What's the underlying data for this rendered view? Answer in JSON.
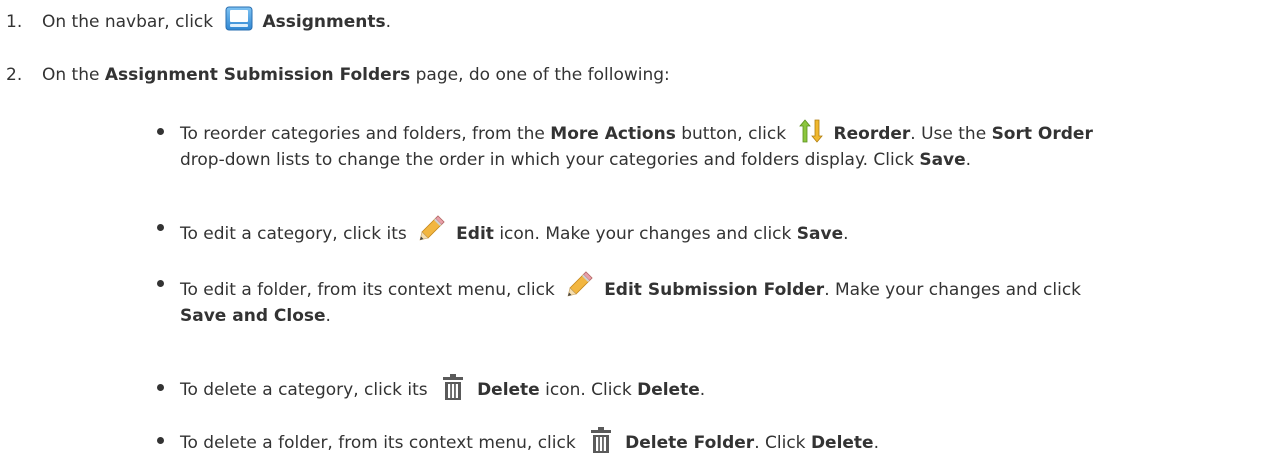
{
  "steps": [
    {
      "number": "1.",
      "prefix": "On the navbar, click",
      "icon": "assignments-icon",
      "bold": "Assignments",
      "suffix": "."
    },
    {
      "number": "2.",
      "prefix": "On the",
      "bold": "Assignment Submission Folders",
      "suffix": "page, do one of the following:"
    }
  ],
  "bullets": {
    "reorder": {
      "t1": "To reorder categories and folders, from the",
      "b1": "More Actions",
      "t2": "button, click",
      "icon": "reorder-icon",
      "b2": "Reorder",
      "t3": ". Use the",
      "b3": "Sort Order",
      "t4": "drop-down lists to change the order in which your categories and folders display. Click",
      "b4": "Save",
      "t5": "."
    },
    "edit_category": {
      "t1": "To edit a category, click its",
      "icon": "pencil-icon",
      "b1": "Edit",
      "t2": "icon. Make your changes and click",
      "b2": "Save",
      "t3": "."
    },
    "edit_folder": {
      "t1": "To edit a folder, from its context menu, click",
      "icon": "pencil-icon",
      "b1": "Edit Submission Folder",
      "t2": ". Make your changes and click",
      "b2": "Save and Close",
      "t3": "."
    },
    "delete_category": {
      "t1": "To delete a category, click its",
      "icon": "trash-icon",
      "b1": "Delete",
      "t2": "icon. Click",
      "b2": "Delete",
      "t3": "."
    },
    "delete_folder": {
      "t1": "To delete a folder, from its context menu, click",
      "icon": "trash-icon",
      "b1": "Delete Folder",
      "t2": ". Click",
      "b2": "Delete",
      "t3": "."
    }
  }
}
